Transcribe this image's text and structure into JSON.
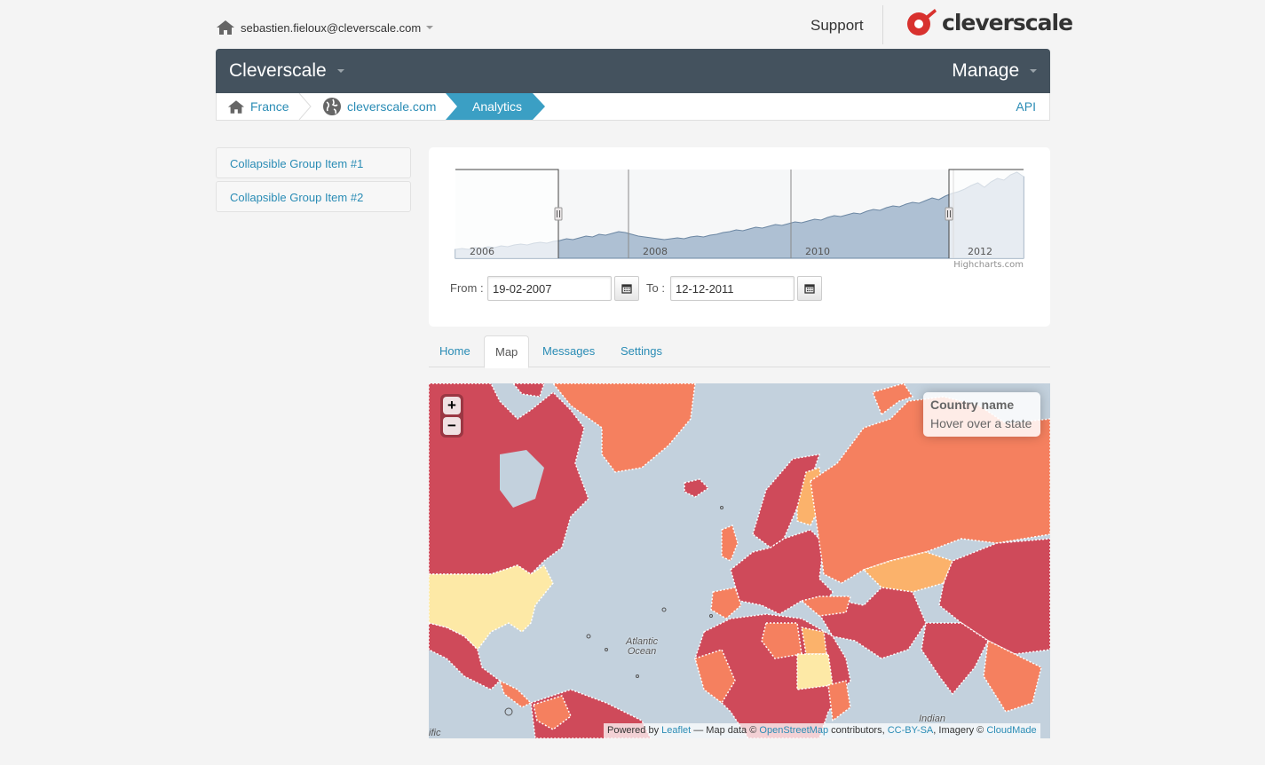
{
  "header": {
    "user_email": "sebastien.fieloux@cleverscale.com",
    "support_label": "Support",
    "logo_text": "cleverscale"
  },
  "navbar": {
    "brand": "Cleverscale",
    "manage": "Manage"
  },
  "breadcrumb": {
    "items": [
      "France",
      "cleverscale.com",
      "Analytics"
    ],
    "api_label": "API"
  },
  "sidebar": {
    "items": [
      "Collapsible Group Item #1",
      "Collapsible Group Item #2"
    ]
  },
  "chart": {
    "x_ticks": [
      "2006",
      "2008",
      "2010",
      "2012"
    ],
    "credit": "Highcharts.com",
    "from_label": "From :",
    "to_label": "To :",
    "from_value": "19-02-2007",
    "to_value": "12-12-2011",
    "series_values": [
      10,
      11,
      10,
      12,
      11,
      13,
      12,
      14,
      13,
      15,
      16,
      15,
      17,
      18,
      17,
      19,
      20,
      22,
      21,
      23,
      25,
      24,
      27,
      26,
      28,
      30,
      29,
      27,
      25,
      24,
      23,
      22,
      21,
      22,
      23,
      22,
      24,
      25,
      24,
      26,
      27,
      29,
      30,
      32,
      31,
      33,
      35,
      34,
      36,
      38,
      37,
      39,
      41,
      40,
      42,
      44,
      43,
      46,
      48,
      47,
      49,
      51,
      50,
      53,
      55,
      54,
      57,
      59,
      58,
      61,
      63,
      62,
      65,
      68,
      66,
      70,
      73,
      75,
      78,
      82,
      85,
      80,
      86,
      90,
      88,
      94,
      97,
      92
    ]
  },
  "tabs": {
    "items": [
      "Home",
      "Map",
      "Messages",
      "Settings"
    ],
    "active": "Map"
  },
  "map": {
    "zoom_in": "+",
    "zoom_out": "−",
    "info_title": "Country name",
    "info_text": "Hover over a state",
    "ocean_label_1": "Atlantic",
    "ocean_label_2": "Ocean",
    "indian_label": "Indian",
    "pacific_label": "ific",
    "attribution": {
      "powered": "Powered by",
      "leaflet": "Leaflet",
      "map_data": "— Map data ©",
      "osm": "OpenStreetMap",
      "contributors": "contributors,",
      "license": "CC-BY-SA",
      "imagery": ", Imagery ©",
      "cloudmade": "CloudMade"
    },
    "colors": {
      "high": "#cf4a5a",
      "medium": "#f5805f",
      "low": "#fbb26b",
      "lowest": "#fde9a6",
      "water": "#c3d1dd"
    }
  }
}
